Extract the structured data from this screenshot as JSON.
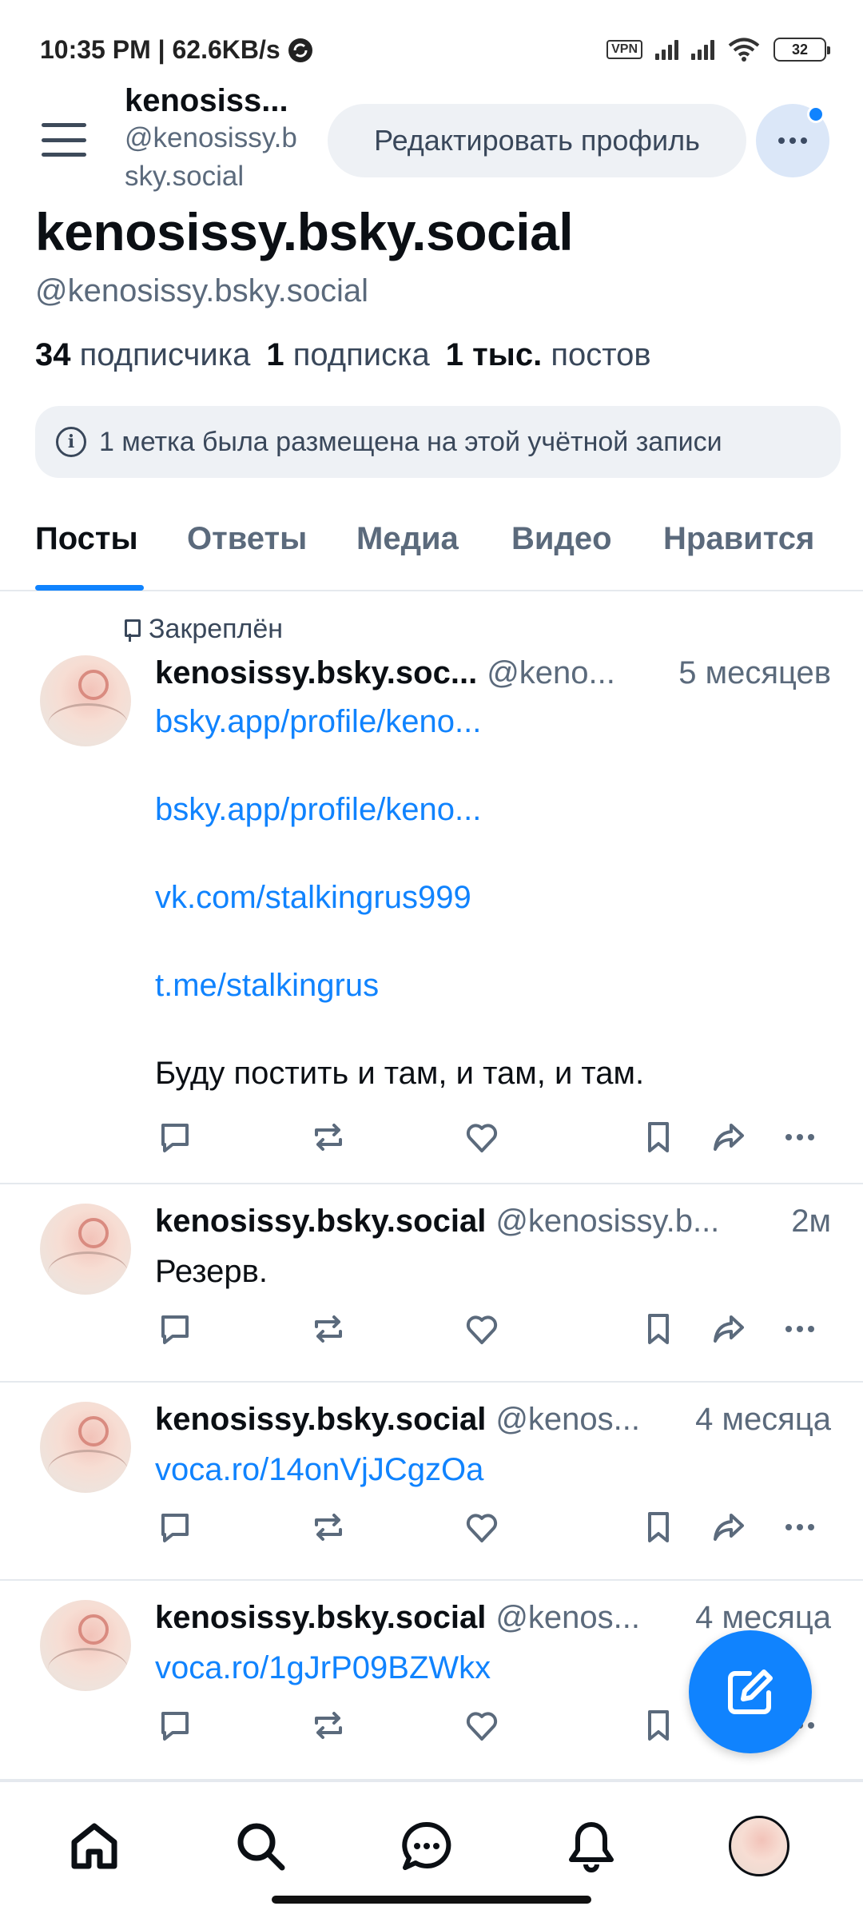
{
  "status_bar": {
    "time_speed": "10:35 PM | 62.6KB/s",
    "vpn": "VPN",
    "battery": "32"
  },
  "header": {
    "title": "kenosiss...",
    "handle": "@kenosissy.bsky.social",
    "edit_button": "Редактировать профиль"
  },
  "profile": {
    "name": "kenosissy.bsky.social",
    "handle": "@kenosissy.bsky.social",
    "followers_count": "34",
    "followers_label": "подписчика",
    "following_count": "1",
    "following_label": "подписка",
    "posts_count": "1 тыс.",
    "posts_label": "постов",
    "labels_notice": "1 метка была размещена на этой учётной записи"
  },
  "tabs": [
    "Посты",
    "Ответы",
    "Медиа",
    "Видео",
    "Нравится"
  ],
  "posts": [
    {
      "pinned_label": "Закреплён",
      "name": "kenosissy.bsky.soc...",
      "handle": "@keno...",
      "time": "5 месяцев",
      "links": [
        "bsky.app/profile/keno...",
        "bsky.app/profile/keno...",
        "vk.com/stalkingrus999",
        "t.me/stalkingrus"
      ],
      "text": "Буду постить и там, и там, и там."
    },
    {
      "name": "kenosissy.bsky.social",
      "handle": "@kenosissy.b...",
      "time": "2м",
      "text": "Резерв."
    },
    {
      "name": "kenosissy.bsky.social",
      "handle": "@kenos...",
      "time": "4 месяца",
      "link": "voca.ro/14onVjJCgzOa"
    },
    {
      "name": "kenosissy.bsky.social",
      "handle": "@kenos...",
      "time": "4 месяца",
      "link": "voca.ro/1gJrP09BZWkx"
    }
  ],
  "colors": {
    "accent": "#1083fe",
    "muted_text": "#5b6a7c",
    "chip_bg": "#eef1f5"
  },
  "icons": {
    "reply": "speech-bubble-icon",
    "repost": "repost-arrows-icon",
    "like": "heart-icon",
    "bookmark": "bookmark-icon",
    "share": "share-arrow-icon",
    "more": "ellipsis-icon",
    "compose": "compose-pencil-icon",
    "nav": [
      "home-icon",
      "search-icon",
      "chat-icon",
      "bell-icon",
      "profile-avatar"
    ]
  }
}
